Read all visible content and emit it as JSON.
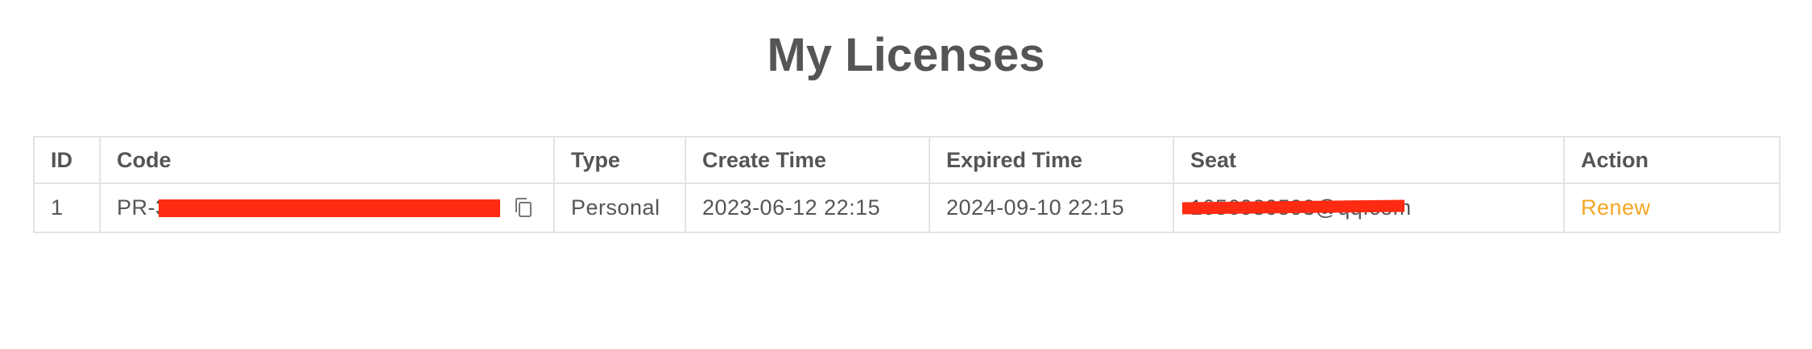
{
  "page": {
    "title": "My Licenses"
  },
  "table": {
    "columns": [
      "ID",
      "Code",
      "Type",
      "Create Time",
      "Expired Time",
      "Seat",
      "Action"
    ],
    "rows": [
      {
        "id": "1",
        "code": "PR-3",
        "type": "Personal",
        "create_time": "2023-06-12 22:15",
        "expired_time": "2024-09-10 22:15",
        "seat": "1056980593@qq.com",
        "action": "Renew"
      }
    ]
  },
  "icons": {
    "copy": "copy-icon"
  },
  "colors": {
    "text": "#555555",
    "action_link": "#f5a623",
    "border": "#e3e3e3",
    "redaction": "#ff2a12"
  }
}
